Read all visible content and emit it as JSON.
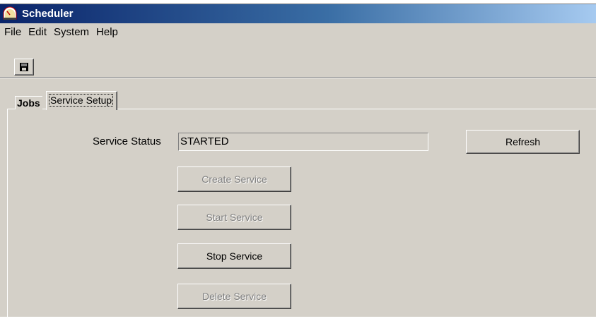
{
  "window": {
    "title": "Scheduler",
    "app_icon": "scheduler-clock-icon"
  },
  "menu": {
    "items": [
      "File",
      "Edit",
      "System",
      "Help"
    ]
  },
  "toolbar": {
    "save_icon": "floppy-disk-icon"
  },
  "tabs": [
    {
      "label": "Jobs",
      "selected": false
    },
    {
      "label": "Service Setup",
      "selected": true
    }
  ],
  "service_setup": {
    "status_label": "Service Status",
    "status_value": "STARTED",
    "refresh_label": "Refresh",
    "buttons": [
      {
        "label": "Create Service",
        "enabled": false
      },
      {
        "label": "Start Service",
        "enabled": false
      },
      {
        "label": "Stop Service",
        "enabled": true
      },
      {
        "label": "Delete Service",
        "enabled": false
      }
    ]
  },
  "colors": {
    "window_bg": "#d4d0c8",
    "titlebar_start": "#0a246a",
    "titlebar_end": "#a6caf0",
    "disabled_text": "#808080"
  }
}
